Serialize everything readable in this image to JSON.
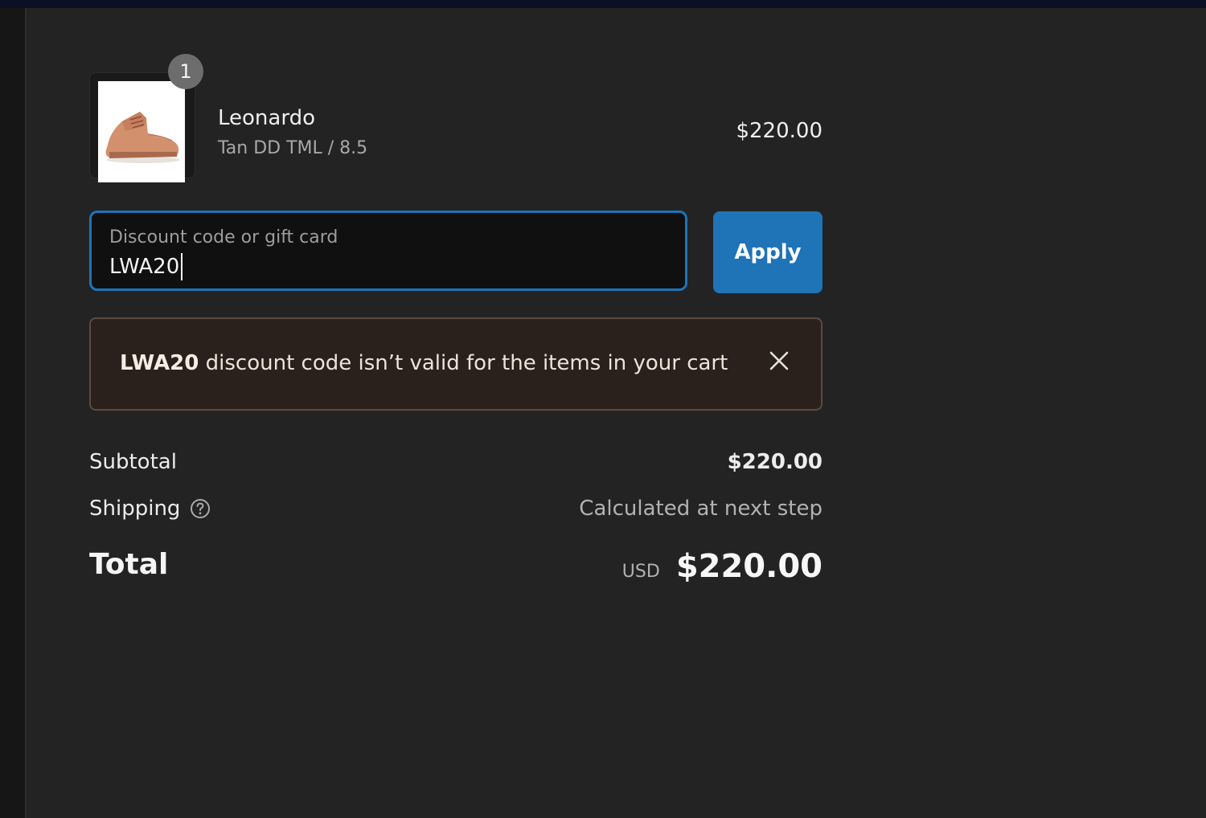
{
  "product": {
    "quantity": "1",
    "name": "Leonardo",
    "variant": "Tan DD TML / 8.5",
    "price": "$220.00"
  },
  "discount": {
    "label": "Discount code or gift card",
    "value": "LWA20",
    "apply_label": "Apply"
  },
  "error": {
    "code": "LWA20",
    "message": "discount code isn’t valid for the items in your cart"
  },
  "totals": {
    "subtotal_label": "Subtotal",
    "subtotal_value": "$220.00",
    "shipping_label": "Shipping",
    "shipping_value": "Calculated at next step",
    "total_label": "Total",
    "currency": "USD",
    "total_value": "$220.00"
  },
  "colors": {
    "accent": "#1f73b7",
    "background": "#232323",
    "error_background": "#2a211d"
  },
  "icons": {
    "product_image": "boot-image",
    "close": "close-icon",
    "help": "help-circle-icon"
  }
}
